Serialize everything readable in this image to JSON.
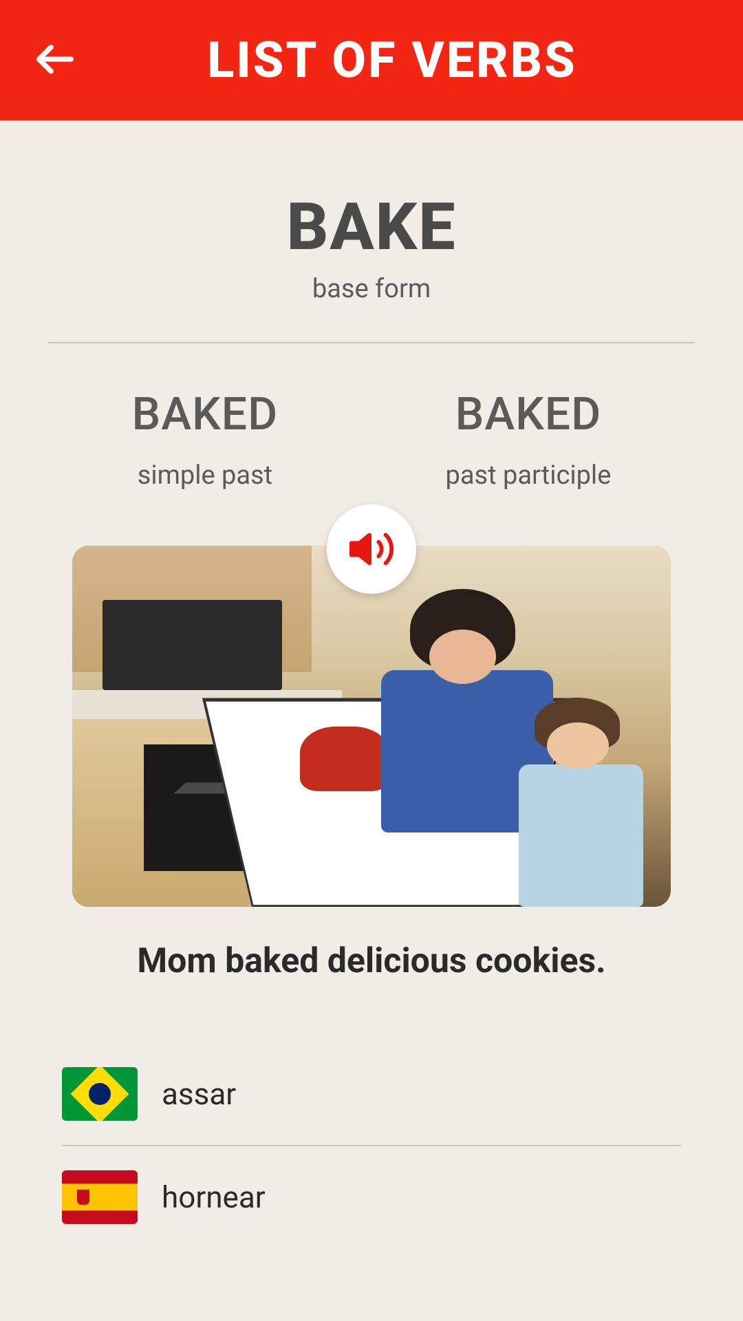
{
  "header": {
    "title": "LIST OF VERBS"
  },
  "verb": {
    "base_form": "BAKE",
    "base_form_label": "base form",
    "simple_past": "BAKED",
    "simple_past_label": "simple past",
    "past_participle": "BAKED",
    "past_participle_label": "past participle"
  },
  "sentence": "Mom baked delicious cookies.",
  "translations": [
    {
      "language": "brazil",
      "word": "assar"
    },
    {
      "language": "spain",
      "word": "hornear"
    }
  ]
}
